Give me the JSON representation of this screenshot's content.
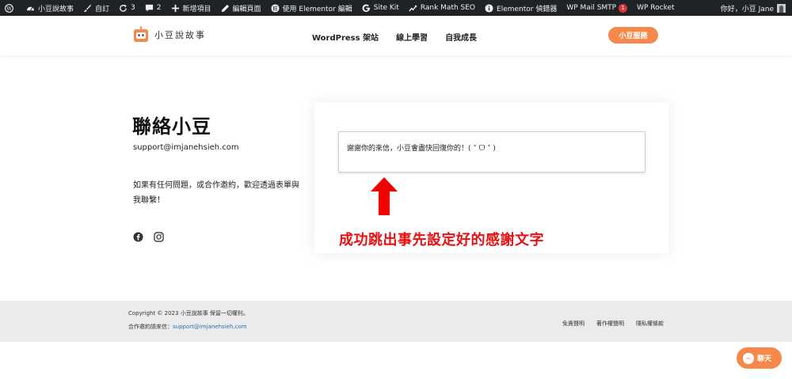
{
  "adminbar": {
    "site_name": "小豆說故事",
    "customize": "自訂",
    "updates_count": "3",
    "comments_count": "2",
    "new_item": "新增項目",
    "edit_page": "編輯頁面",
    "edit_elementor": "使用 Elementor 編輯",
    "site_kit": "Site Kit",
    "rank_math": "Rank Math SEO",
    "elementor_inspector": "Elementor 偵錯器",
    "wp_mail_smtp": "WP Mail SMTP",
    "wp_mail_smtp_badge": "1",
    "wp_rocket": "WP Rocket",
    "greeting": "你好，小豆 Jane"
  },
  "header": {
    "logo_text": "小豆說故事",
    "nav": [
      {
        "label": "WordPress 架站"
      },
      {
        "label": "線上學習"
      },
      {
        "label": "自我成長"
      }
    ],
    "cta_label": "小豆服務"
  },
  "contact": {
    "title": "聯絡小豆",
    "email": "support@imjanehsieh.com",
    "description": "如果有任何問題，或合作邀約，歡迎透過表單與我聯繫！",
    "social_icons": [
      "facebook-icon",
      "instagram-icon"
    ]
  },
  "form": {
    "success_message": "謝謝你的來信，小豆會盡快回復你的！( ˃ ᗜ ˂ )"
  },
  "annotation": {
    "text": "成功跳出事先設定好的感謝文字"
  },
  "footer": {
    "copyright": "Copyright © 2023 小豆說故事 保留一切權利。",
    "contact_prefix": "合作邀約請來信：",
    "contact_email": "support@imjanehsieh.com",
    "links": [
      {
        "label": "免責聲明"
      },
      {
        "label": "著作權聲明"
      },
      {
        "label": "隱私權條款"
      }
    ]
  },
  "chat": {
    "label": "聊天"
  },
  "colors": {
    "accent": "#f5894b",
    "adminbar_bg": "#1d2327",
    "annotation_red": "#e81010",
    "footer_bg": "#ebebeb",
    "link_blue": "#2c6fb3"
  }
}
